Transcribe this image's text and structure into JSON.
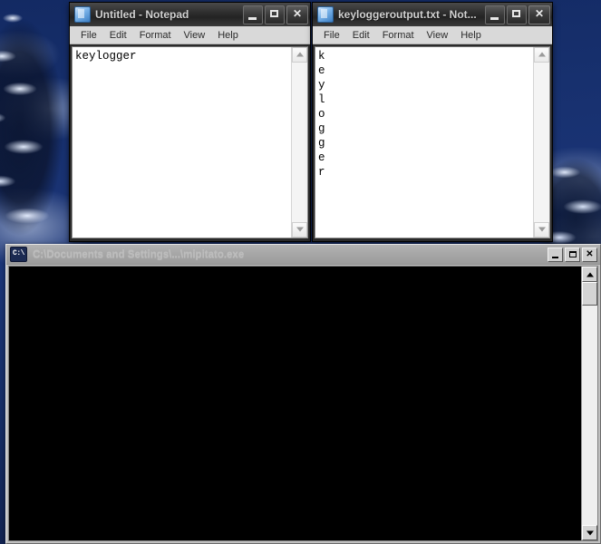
{
  "desktop": {
    "wallpaper_description": "snowy-pine-trees-blue",
    "sky_color": "#1b3578",
    "snow_color": "#e8f0ff"
  },
  "windows": {
    "notepad1": {
      "title": "Untitled - Notepad",
      "icon": "notepad-icon",
      "menu": [
        "File",
        "Edit",
        "Format",
        "View",
        "Help"
      ],
      "content": "keylogger",
      "buttons": {
        "minimize": "_",
        "maximize": "□",
        "close": "✕"
      }
    },
    "notepad2": {
      "title": "keyloggeroutput.txt - Not...",
      "icon": "notepad-icon",
      "menu": [
        "File",
        "Edit",
        "Format",
        "View",
        "Help"
      ],
      "content": "k\ne\ny\nl\no\ng\ng\ne\nr",
      "buttons": {
        "minimize": "_",
        "maximize": "□",
        "close": "✕"
      }
    },
    "cmd": {
      "title": "C:\\Documents and Settings\\...\\mipitato.exe",
      "icon": "cmd-icon",
      "icon_glyph": "C:\\",
      "content": "",
      "buttons": {
        "minimize": "_",
        "maximize": "□",
        "close": "✕"
      }
    }
  }
}
